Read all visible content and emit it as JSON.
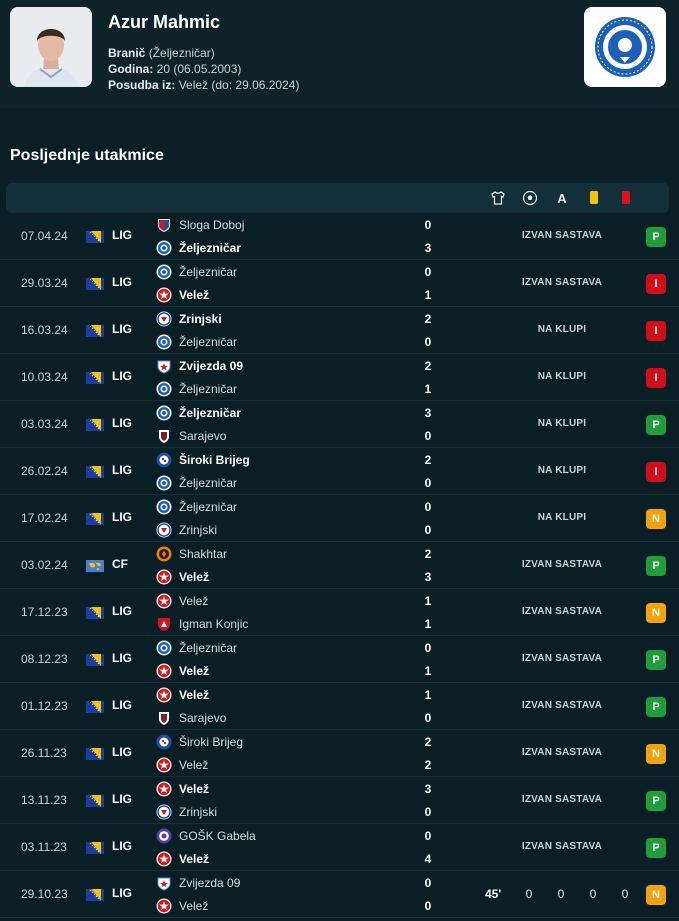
{
  "player": {
    "name": "Azur Mahmic",
    "position_label": "Branič",
    "position_value": "(Željezničar)",
    "age_label": "Godina:",
    "age_value": "20 (06.05.2003)",
    "loan_label": "Posudba iz:",
    "loan_value": "Velež (do: 29.06.2024)"
  },
  "section_title": "Posljednje utakmice",
  "stat_headers": [
    "shirt-icon",
    "ball-icon",
    "assist-icon",
    "yellow-card-icon",
    "red-card-icon"
  ],
  "stat_header_letter": "A",
  "colors": {
    "win": "#1f9d3a",
    "loss": "#d10f1a",
    "draw": "#f2a20c",
    "background": "#0a1e26"
  },
  "matches": [
    {
      "date": "07.04.24",
      "competition": "LIG",
      "flag": "bih",
      "home": "Sloga Doboj",
      "away": "Željezničar",
      "home_score": "0",
      "away_score": "3",
      "winner": "away",
      "home_crest": "sloga",
      "away_crest": "zeljo",
      "status": "IZVAN SASTAVA",
      "result": "P"
    },
    {
      "date": "29.03.24",
      "competition": "LIG",
      "flag": "bih",
      "home": "Željezničar",
      "away": "Velež",
      "home_score": "0",
      "away_score": "1",
      "winner": "away",
      "home_crest": "zeljo",
      "away_crest": "velez",
      "status": "IZVAN SASTAVA",
      "result": "I"
    },
    {
      "date": "16.03.24",
      "competition": "LIG",
      "flag": "bih",
      "home": "Zrinjski",
      "away": "Željezničar",
      "home_score": "2",
      "away_score": "0",
      "winner": "home",
      "home_crest": "zrinjski",
      "away_crest": "zeljo",
      "status": "NA KLUPI",
      "result": "I"
    },
    {
      "date": "10.03.24",
      "competition": "LIG",
      "flag": "bih",
      "home": "Zvijezda 09",
      "away": "Željezničar",
      "home_score": "2",
      "away_score": "1",
      "winner": "home",
      "home_crest": "zvijezda",
      "away_crest": "zeljo",
      "status": "NA KLUPI",
      "result": "I"
    },
    {
      "date": "03.03.24",
      "competition": "LIG",
      "flag": "bih",
      "home": "Željezničar",
      "away": "Sarajevo",
      "home_score": "3",
      "away_score": "0",
      "winner": "home",
      "home_crest": "zeljo",
      "away_crest": "sarajevo",
      "status": "NA KLUPI",
      "result": "P"
    },
    {
      "date": "26.02.24",
      "competition": "LIG",
      "flag": "bih",
      "home": "Široki Brijeg",
      "away": "Željezničar",
      "home_score": "2",
      "away_score": "0",
      "winner": "home",
      "home_crest": "siroki",
      "away_crest": "zeljo",
      "status": "NA KLUPI",
      "result": "I"
    },
    {
      "date": "17.02.24",
      "competition": "LIG",
      "flag": "bih",
      "home": "Željezničar",
      "away": "Zrinjski",
      "home_score": "0",
      "away_score": "0",
      "winner": "none",
      "home_crest": "zeljo",
      "away_crest": "zrinjski",
      "status": "NA KLUPI",
      "result": "N"
    },
    {
      "date": "03.02.24",
      "competition": "CF",
      "flag": "world",
      "home": "Shakhtar",
      "away": "Velež",
      "home_score": "2",
      "away_score": "3",
      "winner": "away",
      "home_crest": "shakhtar",
      "away_crest": "velez",
      "status": "IZVAN SASTAVA",
      "result": "P"
    },
    {
      "date": "17.12.23",
      "competition": "LIG",
      "flag": "bih",
      "home": "Velež",
      "away": "Igman Konjic",
      "home_score": "1",
      "away_score": "1",
      "winner": "none",
      "home_crest": "velez",
      "away_crest": "igman",
      "status": "IZVAN SASTAVA",
      "result": "N"
    },
    {
      "date": "08.12.23",
      "competition": "LIG",
      "flag": "bih",
      "home": "Željezničar",
      "away": "Velež",
      "home_score": "0",
      "away_score": "1",
      "winner": "away",
      "home_crest": "zeljo",
      "away_crest": "velez",
      "status": "IZVAN SASTAVA",
      "result": "P"
    },
    {
      "date": "01.12.23",
      "competition": "LIG",
      "flag": "bih",
      "home": "Velež",
      "away": "Sarajevo",
      "home_score": "1",
      "away_score": "0",
      "winner": "home",
      "home_crest": "velez",
      "away_crest": "sarajevo",
      "status": "IZVAN SASTAVA",
      "result": "P"
    },
    {
      "date": "26.11.23",
      "competition": "LIG",
      "flag": "bih",
      "home": "Široki Brijeg",
      "away": "Velež",
      "home_score": "2",
      "away_score": "2",
      "winner": "none",
      "home_crest": "siroki",
      "away_crest": "velez",
      "status": "IZVAN SASTAVA",
      "result": "N"
    },
    {
      "date": "13.11.23",
      "competition": "LIG",
      "flag": "bih",
      "home": "Velež",
      "away": "Zrinjski",
      "home_score": "3",
      "away_score": "0",
      "winner": "home",
      "home_crest": "velez",
      "away_crest": "zrinjski",
      "status": "IZVAN SASTAVA",
      "result": "P"
    },
    {
      "date": "03.11.23",
      "competition": "LIG",
      "flag": "bih",
      "home": "GOŠK Gabela",
      "away": "Velež",
      "home_score": "0",
      "away_score": "4",
      "winner": "away",
      "home_crest": "gosk",
      "away_crest": "velez",
      "status": "IZVAN SASTAVA",
      "result": "P"
    },
    {
      "date": "29.10.23",
      "competition": "LIG",
      "flag": "bih",
      "home": "Zvijezda 09",
      "away": "Velež",
      "home_score": "0",
      "away_score": "0",
      "winner": "none",
      "home_crest": "zvijezda",
      "away_crest": "velez",
      "status": "",
      "minutes": "45'",
      "stats": [
        "0",
        "0",
        "0",
        "0"
      ],
      "result": "N"
    }
  ]
}
